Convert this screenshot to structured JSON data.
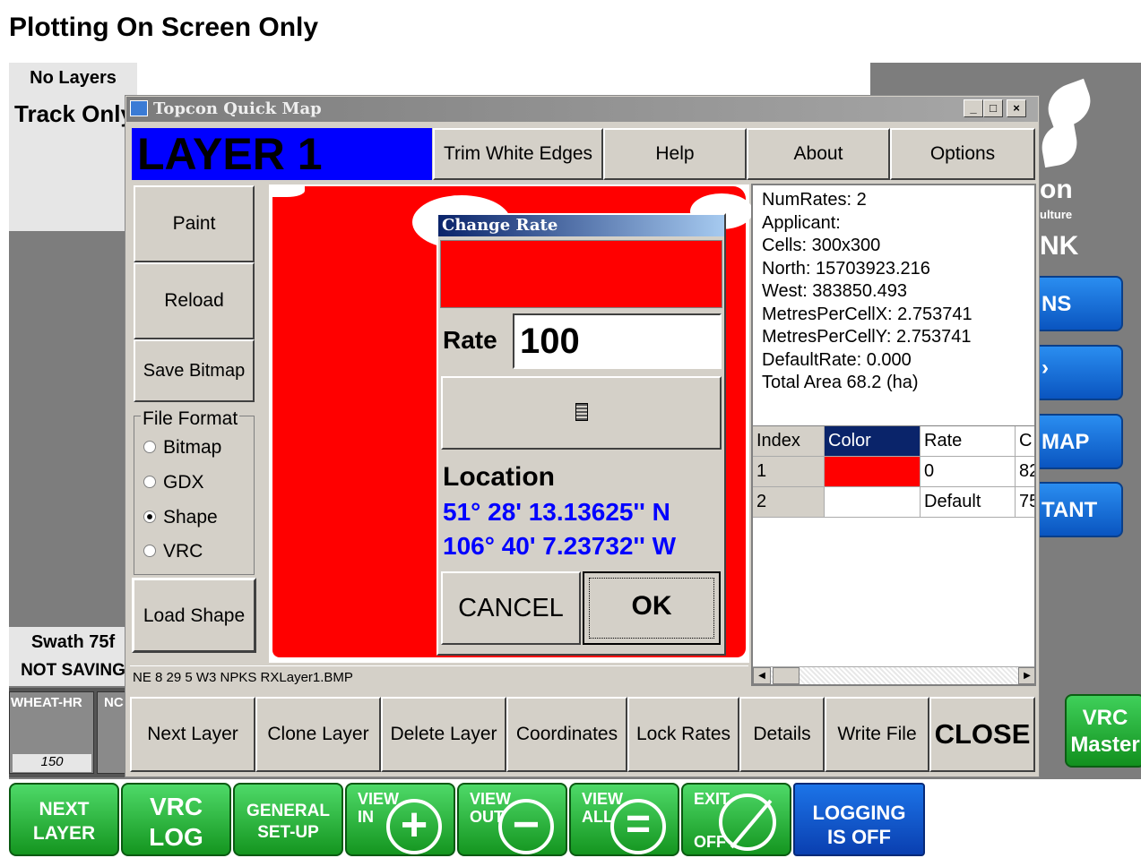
{
  "background": {
    "title": "Plotting On Screen Only",
    "no_layers": "No Layers",
    "track_only": "Track Only",
    "logo_text": "on",
    "logo_sub": "ulture",
    "logo_nk": "NK",
    "right_buttons": [
      "NS",
      "",
      "MAP",
      "TANT"
    ],
    "swath": "Swath 75f",
    "not_saving": "NOT SAVING",
    "crop_label_1": "WHEAT-HR",
    "crop_label_2": "NC",
    "crop_value": "150",
    "vrc_master_line1": "VRC",
    "vrc_master_line2": "Master"
  },
  "bottom_bar": {
    "next_layer": [
      "NEXT",
      "LAYER"
    ],
    "vrc_log": [
      "VRC",
      "LOG"
    ],
    "general_setup": [
      "GENERAL",
      "SET-UP"
    ],
    "view_in": [
      "VIEW",
      "IN"
    ],
    "view_out": [
      "VIEW",
      "OUT"
    ],
    "view_all": [
      "VIEW",
      "ALL"
    ],
    "exit": [
      "EXIT",
      "OFF"
    ],
    "logging": [
      "LOGGING",
      "IS OFF"
    ]
  },
  "window": {
    "title": "Topcon Quick Map",
    "min": "_",
    "max": "□",
    "close": "×",
    "layer_title": "LAYER 1",
    "top_buttons": [
      "Trim White Edges",
      "Help",
      "About",
      "Options"
    ],
    "left_buttons": [
      "Paint",
      "Reload",
      "Save Bitmap"
    ],
    "file_format_label": "File Format",
    "file_formats": [
      "Bitmap",
      "GDX",
      "Shape",
      "VRC"
    ],
    "selected_format": "Shape",
    "load_shape": "Load Shape",
    "status_file": "NE 8 29 5 W3 NPKS RXLayer1.BMP",
    "info": [
      "NumRates: 2",
      "Applicant:",
      "Cells: 300x300",
      "North: 15703923.216",
      "West: 383850.493",
      "MetresPerCellX: 2.753741",
      "MetresPerCellY: 2.753741",
      "DefaultRate: 0.000",
      "Total Area 68.2 (ha)"
    ],
    "grid": {
      "headers": [
        "Index",
        "Color",
        "Rate",
        "C"
      ],
      "rows": [
        {
          "index": "1",
          "color": "#ff0000",
          "rate": "0",
          "c": "82"
        },
        {
          "index": "2",
          "color": "#ffffff",
          "rate": "Default",
          "c": "75"
        }
      ]
    },
    "bottom_buttons": [
      "Next Layer",
      "Clone Layer",
      "Delete Layer",
      "Coordinates",
      "Lock Rates",
      "Details",
      "Write File",
      "CLOSE"
    ]
  },
  "dialog": {
    "title": "Change Rate",
    "swatch_color": "#ff0000",
    "rate_label": "Rate",
    "rate_value": "100",
    "calculator_icon": "calculator-icon",
    "location_label": "Location",
    "latitude": "51° 28' 13.13625'' N",
    "longitude": "106° 40' 7.23732'' W",
    "cancel": "CANCEL",
    "ok": "OK"
  },
  "colors": {
    "map_fill": "#ff0000",
    "layer_bg": "#0000ff",
    "green_button": "#1fae2e",
    "blue_button": "#0a55c0"
  }
}
